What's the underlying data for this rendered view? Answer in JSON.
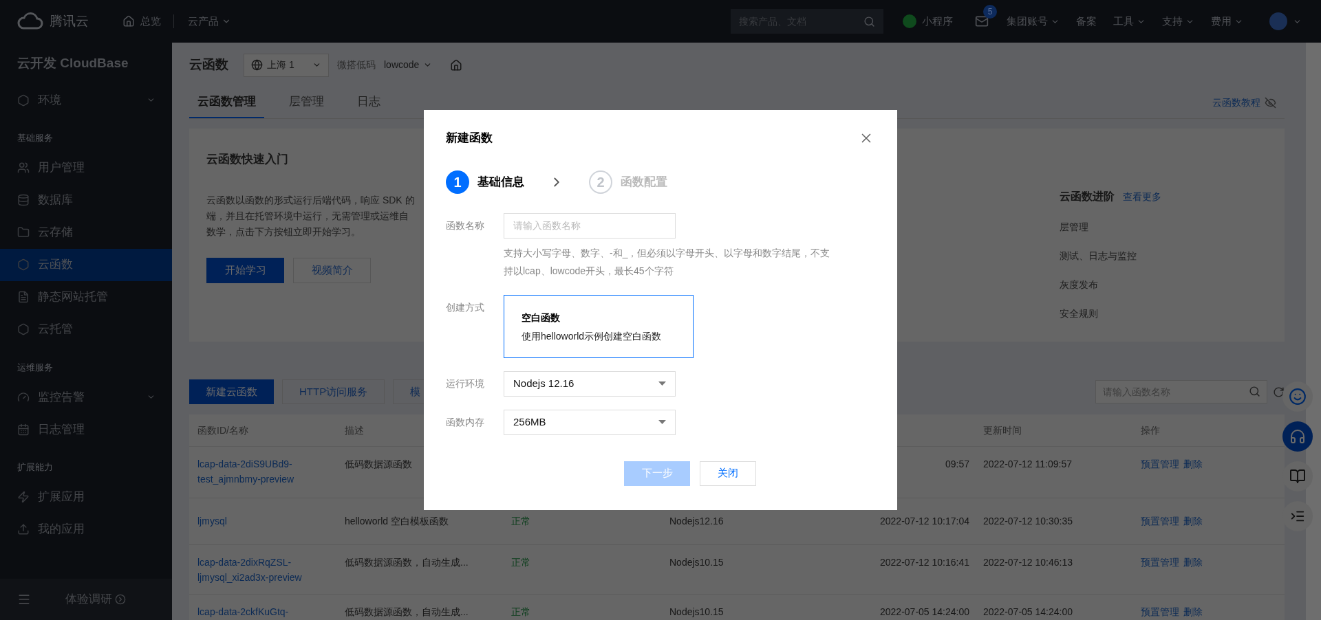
{
  "topbar": {
    "brand": "腾讯云",
    "overview": "总览",
    "products": "云产品",
    "search": {
      "placeholder": "搜索产品、文档"
    },
    "mini_program": "小程序",
    "mail_badge": "5",
    "menus": [
      {
        "label": "集团账号",
        "caret": true
      },
      {
        "label": "备案",
        "caret": false
      },
      {
        "label": "工具",
        "caret": true
      },
      {
        "label": "支持",
        "caret": true
      },
      {
        "label": "费用",
        "caret": true
      }
    ]
  },
  "sidebar": {
    "title": "云开发 CloudBase",
    "groups": [
      {
        "items": [
          {
            "label": "环境",
            "expandable": true,
            "selected": false
          }
        ]
      },
      {
        "heading": "基础服务",
        "items": [
          {
            "label": "用户管理",
            "expandable": false,
            "selected": false
          },
          {
            "label": "数据库",
            "expandable": false,
            "selected": false
          },
          {
            "label": "云存储",
            "expandable": false,
            "selected": false
          },
          {
            "label": "云函数",
            "expandable": false,
            "selected": true
          },
          {
            "label": "静态网站托管",
            "expandable": false,
            "selected": false
          },
          {
            "label": "云托管",
            "expandable": false,
            "selected": false
          }
        ]
      },
      {
        "heading": "运维服务",
        "items": [
          {
            "label": "监控告警",
            "expandable": true,
            "selected": false
          },
          {
            "label": "日志管理",
            "expandable": false,
            "selected": false
          }
        ]
      },
      {
        "heading": "扩展能力",
        "items": [
          {
            "label": "扩展应用",
            "expandable": false,
            "selected": false
          },
          {
            "label": "我的应用",
            "expandable": false,
            "selected": false
          }
        ]
      }
    ],
    "survey": "体验调研"
  },
  "header": {
    "title": "云函数",
    "region": "上海 1",
    "env_label": "微搭低码",
    "env": "lowcode",
    "tabs": [
      {
        "label": "云函数管理",
        "selected": true
      },
      {
        "label": "层管理",
        "selected": false
      },
      {
        "label": "日志",
        "selected": false
      }
    ],
    "tutorial": "云函数教程"
  },
  "quickstart": {
    "title": "云函数快速入门",
    "lines": [
      "云函数以函数的形式运行后端代码，响应 SDK 的",
      "端，并且在托管环境中运行，无需管理或运维自",
      "数学，点击下方按钮立即开始学习。"
    ],
    "primary": "开始学习",
    "secondary": "视频简介",
    "advanced": {
      "title": "云函数进阶",
      "more": "查看更多",
      "items": [
        "层管理",
        "测试、日志与监控",
        "灰度发布",
        "安全规则"
      ]
    }
  },
  "toolbar": {
    "buttons": [
      {
        "label": "新建云函数",
        "primary": true
      },
      {
        "label": "HTTP访问服务",
        "primary": false
      },
      {
        "label": "模",
        "primary": false
      }
    ],
    "search": {
      "placeholder": "请输入函数名称"
    }
  },
  "table": {
    "header": {
      "name": "函数ID/名称",
      "description": "描述",
      "updated": "更新时间",
      "actions": "操作"
    },
    "rows": [
      {
        "name": "lcap-data-2diS9UBd9-test_ajmnbmy-preview",
        "description": "低码数据源函数",
        "created": "09:57",
        "updated": "2022-07-12 11:09:57",
        "actions": [
          "预置管理",
          "删除"
        ]
      },
      {
        "name": "ljmysql",
        "description": "helloworld 空白模板函数",
        "status": "正常",
        "runtime": "Nodejs12.16",
        "created": "2022-07-12 10:17:04",
        "updated": "2022-07-12 10:30:35",
        "actions": [
          "预置管理",
          "删除"
        ]
      },
      {
        "name": "lcap-data-2dixRqZSL-ljmysql_xi2ad3x-preview",
        "description": "低码数据源函数，自动生成...",
        "status": "正常",
        "runtime": "Nodejs10.15",
        "created": "2022-07-12 10:16:41",
        "updated": "2022-07-12 10:46:13",
        "actions": [
          "预置管理",
          "删除"
        ]
      },
      {
        "name": "lcap-data-2ckfKuGtq-",
        "description": "低码数据源函数，自动生成...",
        "status": "正常",
        "runtime": "Nodejs10.15",
        "created": "2022-07-05 14:24:00",
        "updated": "2022-07-05 14:24:00",
        "actions": [
          "预置管理",
          "删除"
        ]
      }
    ]
  },
  "modal": {
    "title": "新建函数",
    "steps": [
      {
        "number": "1",
        "label": "基础信息",
        "selected": true
      },
      {
        "number": "2",
        "label": "函数配置",
        "selected": false
      }
    ],
    "fields": [
      {
        "kind": "input",
        "label": "函数名称",
        "placeholder": "请输入函数名称",
        "hint": "支持大小写字母、数字、-和_，但必须以字母开头、以字母和数字结尾，不支持以lcap、lowcode开头，最长45个字符"
      },
      {
        "kind": "option",
        "label": "创建方式",
        "option": {
          "title": "空白函数",
          "description": "使用helloworld示例创建空白函数",
          "selected": true
        }
      },
      {
        "kind": "select",
        "label": "运行环境",
        "value": "Nodejs 12.16"
      },
      {
        "kind": "select",
        "label": "函数内存",
        "value": "256MB"
      }
    ],
    "buttons": [
      {
        "label": "下一步",
        "primary": true,
        "disabled": true
      },
      {
        "label": "关闭",
        "primary": false,
        "disabled": false
      }
    ]
  }
}
